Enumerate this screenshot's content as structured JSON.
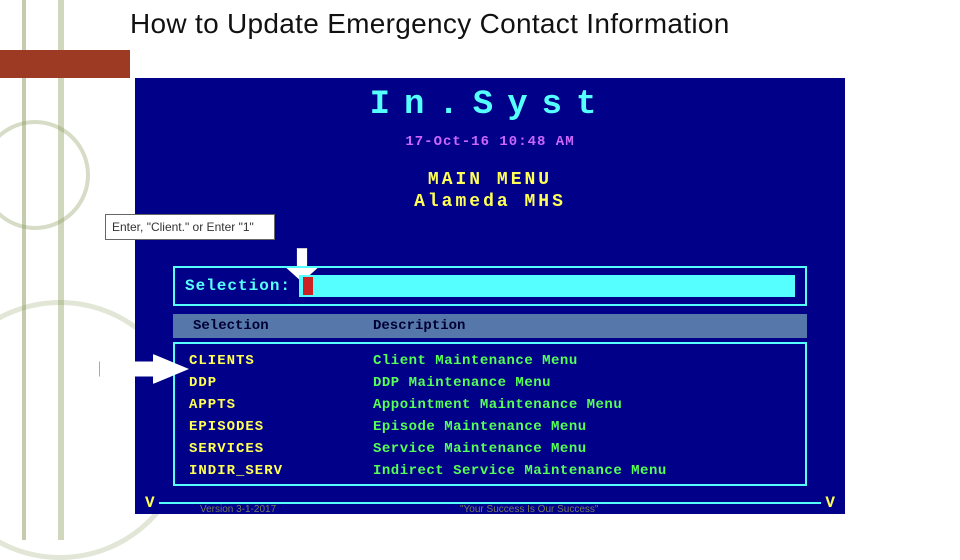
{
  "slide": {
    "title": "How to Update Emergency Contact Information",
    "footer_left": "Version 3-1-2017",
    "footer_right": "\"Your Success Is Our Success\""
  },
  "terminal": {
    "app_name": "In.Syst",
    "datetime": "17-Oct-16   10:48 AM",
    "menu_title": "MAIN MENU",
    "org": "Alameda MHS",
    "callout_text": "Enter, \"Client.\" or Enter \"1\"",
    "selection_label": "Selection:",
    "selection_value": "",
    "headers": {
      "sel": "Selection",
      "desc": "Description"
    },
    "items": [
      {
        "code": "CLIENTS",
        "desc": "Client Maintenance Menu"
      },
      {
        "code": "DDP",
        "desc": "DDP Maintenance Menu"
      },
      {
        "code": "APPTS",
        "desc": "Appointment Maintenance Menu"
      },
      {
        "code": "EPISODES",
        "desc": "Episode Maintenance Menu"
      },
      {
        "code": "SERVICES",
        "desc": "Service Maintenance Menu"
      },
      {
        "code": "INDIR_SERV",
        "desc": "Indirect Service Maintenance Menu"
      }
    ],
    "v_marker": "V"
  }
}
